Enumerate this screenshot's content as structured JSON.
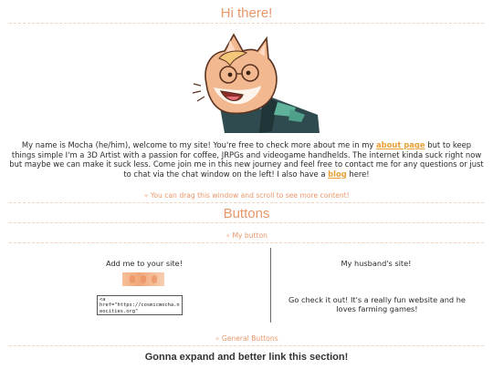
{
  "hero": {
    "title": "Hi there!"
  },
  "intro": {
    "part1": "My name is Mocha (he/him), welcome to my site! You're free to check more about me in my ",
    "about_link": "about page",
    "part2": " but to keep things simple I'm a 3D Artist with a passion for coffee, JRPGs and videogame handhelds. The internet kinda suck right now but maybe we can make it suck less. Come join me in this new journey and feel free to contact me for any questions or just to chat via the chat window on the left! I also have a ",
    "blog_link": "blog",
    "part3": " here!"
  },
  "drag_note": "You can drag this window and scroll to see more content!",
  "buttons_section": {
    "title": "Buttons",
    "my_button_label": "My button",
    "add_me": "Add me to your site!",
    "code_snippet": "<a href=\"https://cosmicmocha.neocities.org\"",
    "husband_title": "My husband's site!",
    "husband_desc": "Go check it out! It's a really fun website and he loves farming games!",
    "general_label": "General Buttons",
    "expand_note": "Gonna expand and better link this section!"
  },
  "colors": {
    "accent": "#e8976a",
    "link": "#e8a036",
    "dash": "#f2d3bd"
  },
  "icons": {
    "note_marker": "sparkle-icon"
  }
}
